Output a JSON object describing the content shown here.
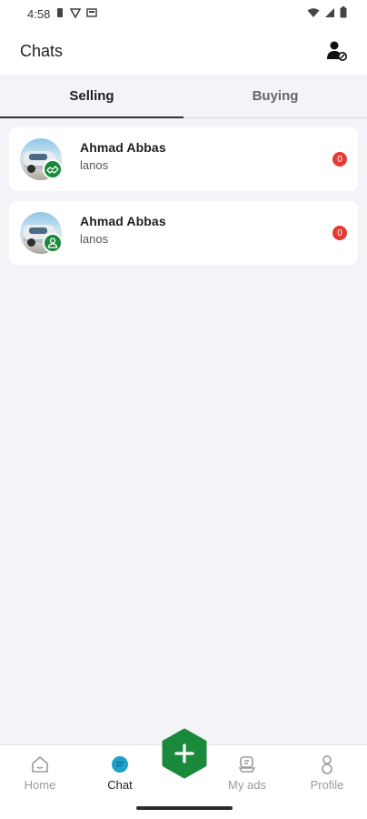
{
  "status_bar": {
    "time": "4:58",
    "left_icons": [
      "sim-icon",
      "vpn-icon",
      "clipboard-icon"
    ],
    "right_icons": [
      "wifi-icon",
      "signal-icon",
      "battery-icon"
    ]
  },
  "header": {
    "title": "Chats",
    "action_icon": "user-block-icon"
  },
  "tabs": [
    {
      "label": "Selling",
      "active": true
    },
    {
      "label": "Buying",
      "active": false
    }
  ],
  "chats": [
    {
      "name": "Ahmad Abbas",
      "subtitle": "lanos",
      "unread": "0",
      "role_icon": "handshake-icon"
    },
    {
      "name": "Ahmad Abbas",
      "subtitle": "lanos",
      "unread": "0",
      "role_icon": "person-icon"
    }
  ],
  "bottom_nav": {
    "items": [
      {
        "label": "Home",
        "icon": "home-icon",
        "active": false
      },
      {
        "label": "Chat",
        "icon": "chat-icon",
        "active": true
      },
      {
        "label": "My ads",
        "icon": "my-ads-icon",
        "active": false
      },
      {
        "label": "Profile",
        "icon": "profile-icon",
        "active": false
      }
    ],
    "fab_icon": "plus-icon"
  },
  "colors": {
    "accent_green": "#1a8a3a",
    "badge_red": "#e53935",
    "chat_active": "#1ea0c8",
    "background": "#f4f4f8"
  }
}
